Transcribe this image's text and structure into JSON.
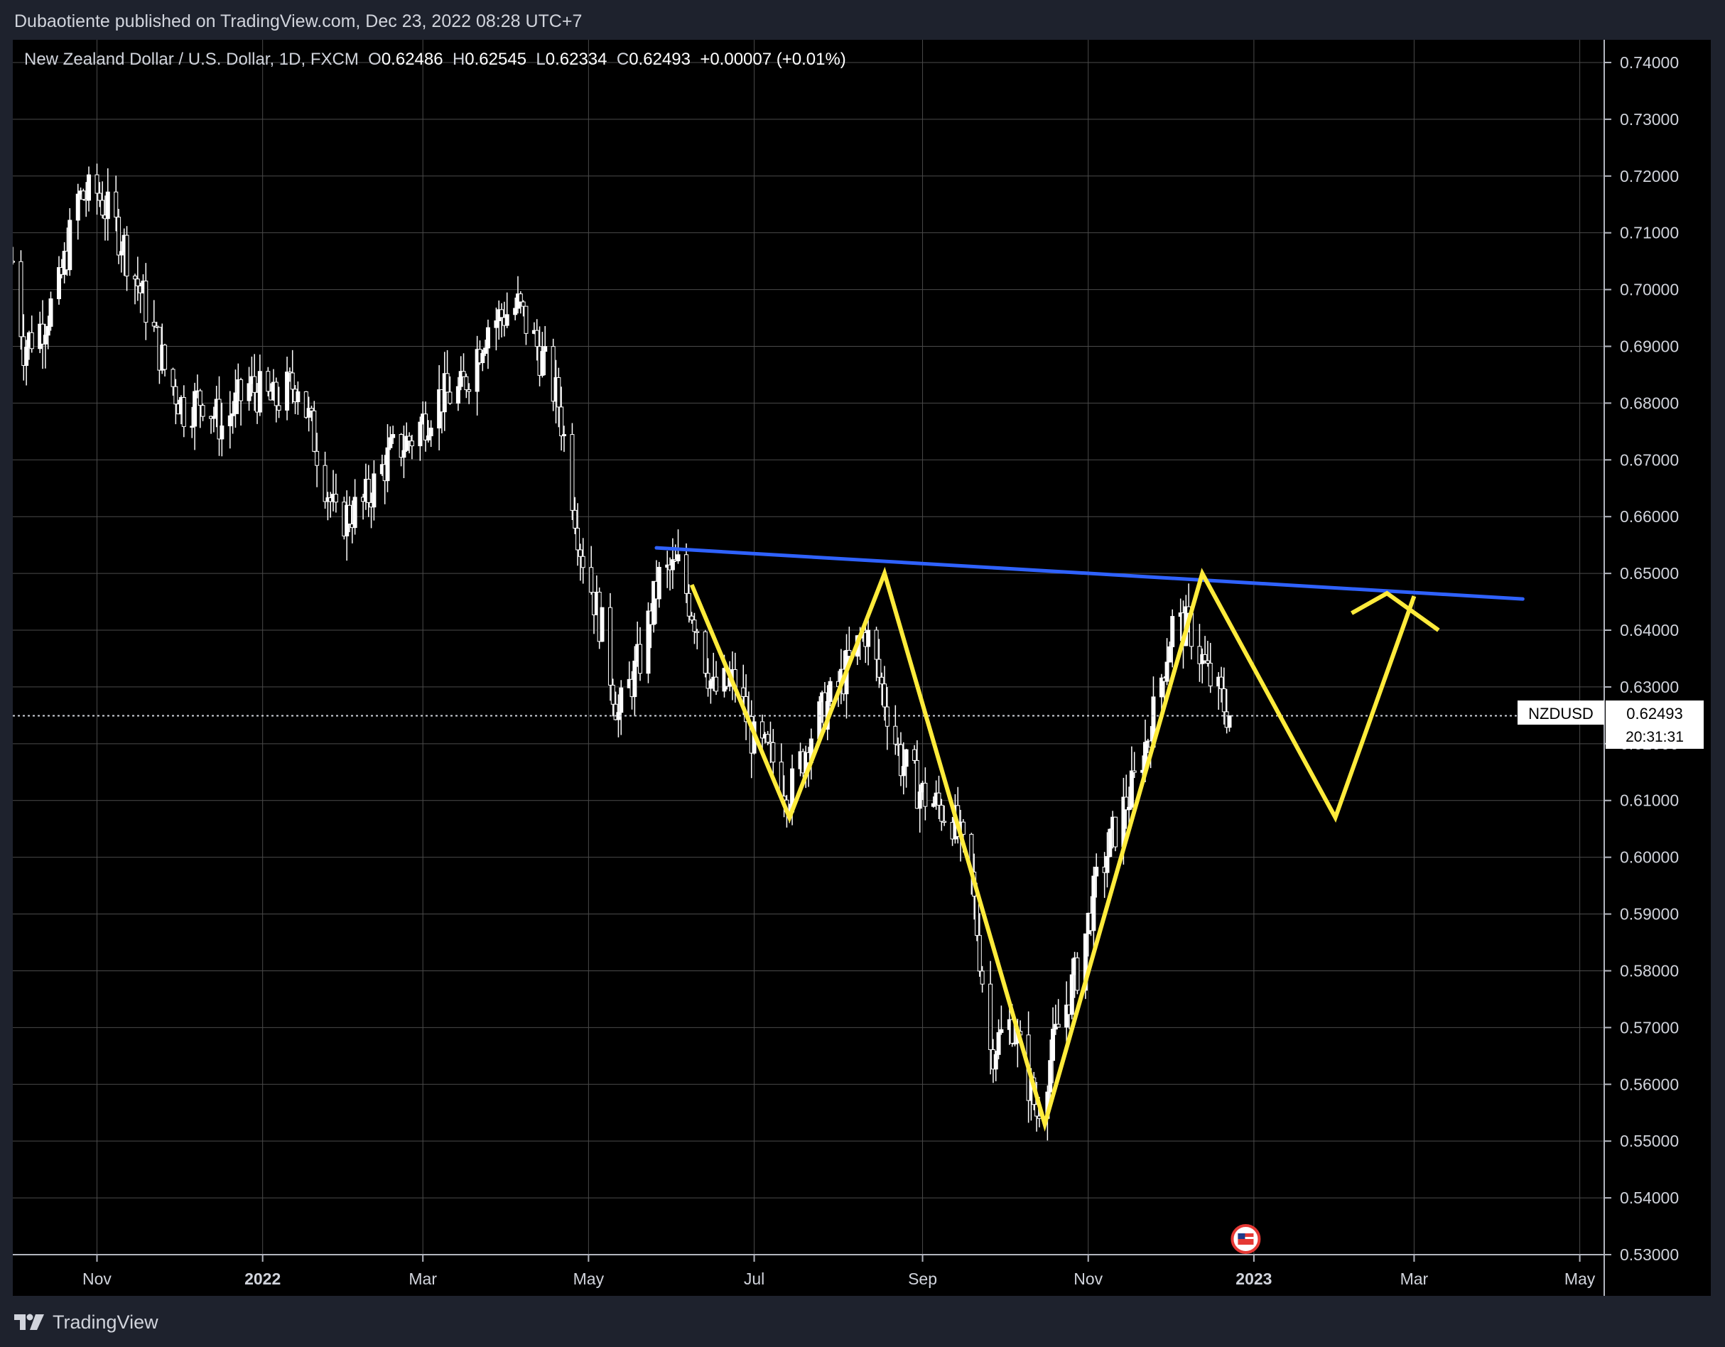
{
  "header": {
    "publisher_line": "Dubaotiente published on TradingView.com, Dec 23, 2022 08:28 UTC+7"
  },
  "legend": {
    "instrument": "New Zealand Dollar / U.S. Dollar, 1D, FXCM",
    "o_label": "O",
    "o_value": "0.62486",
    "h_label": "H",
    "h_value": "0.62545",
    "l_label": "L",
    "l_value": "0.62334",
    "c_label": "C",
    "c_value": "0.62493",
    "change": "+0.00007 (+0.01%)"
  },
  "price_tag": {
    "symbol": "NZDUSD",
    "price": "0.62493",
    "countdown": "20:31:31"
  },
  "footer": {
    "brand": "TradingView"
  },
  "colors": {
    "background": "#000000",
    "frame": "#1e222d",
    "candles": "#ffffff",
    "grid": "#4a4a4a",
    "trendline": "#2f62ff",
    "projection": "#ffeb3b"
  },
  "icons": {
    "event_marker": "us-flag-event-icon",
    "brand": "tradingview-logo-icon"
  },
  "chart_data": {
    "type": "candlestick",
    "title": "New Zealand Dollar / U.S. Dollar, 1D, FXCM",
    "xlabel": "",
    "ylabel": "",
    "ylim": [
      0.53,
      0.744
    ],
    "xlim": [
      "2021-10-01",
      "2023-05-10"
    ],
    "y_ticks": [
      "0.74000",
      "0.73000",
      "0.72000",
      "0.71000",
      "0.70000",
      "0.69000",
      "0.68000",
      "0.67000",
      "0.66000",
      "0.65000",
      "0.64000",
      "0.63000",
      "0.62000",
      "0.61000",
      "0.60000",
      "0.59000",
      "0.58000",
      "0.57000",
      "0.56000",
      "0.55000",
      "0.54000",
      "0.53000"
    ],
    "y_tick_values": [
      0.74,
      0.73,
      0.72,
      0.71,
      0.7,
      0.69,
      0.68,
      0.67,
      0.66,
      0.65,
      0.64,
      0.63,
      0.62,
      0.61,
      0.6,
      0.59,
      0.58,
      0.57,
      0.56,
      0.55,
      0.54,
      0.53
    ],
    "x_ticks": [
      {
        "label": "Nov",
        "date": "2021-11-01"
      },
      {
        "label": "2022",
        "date": "2022-01-01"
      },
      {
        "label": "Mar",
        "date": "2022-03-01"
      },
      {
        "label": "May",
        "date": "2022-05-01"
      },
      {
        "label": "Jul",
        "date": "2022-07-01"
      },
      {
        "label": "Sep",
        "date": "2022-09-01"
      },
      {
        "label": "Nov",
        "date": "2022-11-01"
      },
      {
        "label": "2023",
        "date": "2023-01-01"
      },
      {
        "label": "Mar",
        "date": "2023-03-01"
      },
      {
        "label": "May",
        "date": "2023-05-01"
      }
    ],
    "grid": true,
    "last_price": 0.62493,
    "price_path": [
      {
        "date": "2021-10-01",
        "close": 0.705
      },
      {
        "date": "2021-10-05",
        "close": 0.69
      },
      {
        "date": "2021-10-12",
        "close": 0.694
      },
      {
        "date": "2021-10-18",
        "close": 0.7
      },
      {
        "date": "2021-10-25",
        "close": 0.716
      },
      {
        "date": "2021-11-01",
        "close": 0.717
      },
      {
        "date": "2021-11-10",
        "close": 0.709
      },
      {
        "date": "2021-11-19",
        "close": 0.697
      },
      {
        "date": "2021-11-26",
        "close": 0.686
      },
      {
        "date": "2021-12-03",
        "close": 0.679
      },
      {
        "date": "2021-12-10",
        "close": 0.681
      },
      {
        "date": "2021-12-17",
        "close": 0.676
      },
      {
        "date": "2021-12-27",
        "close": 0.683
      },
      {
        "date": "2022-01-05",
        "close": 0.68
      },
      {
        "date": "2022-01-14",
        "close": 0.684
      },
      {
        "date": "2022-01-21",
        "close": 0.672
      },
      {
        "date": "2022-01-28",
        "close": 0.659
      },
      {
        "date": "2022-02-07",
        "close": 0.662
      },
      {
        "date": "2022-02-17",
        "close": 0.671
      },
      {
        "date": "2022-02-25",
        "close": 0.674
      },
      {
        "date": "2022-03-07",
        "close": 0.681
      },
      {
        "date": "2022-03-15",
        "close": 0.682
      },
      {
        "date": "2022-03-25",
        "close": 0.694
      },
      {
        "date": "2022-04-05",
        "close": 0.697
      },
      {
        "date": "2022-04-12",
        "close": 0.69
      },
      {
        "date": "2022-04-20",
        "close": 0.68
      },
      {
        "date": "2022-04-28",
        "close": 0.655
      },
      {
        "date": "2022-05-06",
        "close": 0.64
      },
      {
        "date": "2022-05-12",
        "close": 0.625
      },
      {
        "date": "2022-05-20",
        "close": 0.635
      },
      {
        "date": "2022-05-27",
        "close": 0.649
      },
      {
        "date": "2022-06-03",
        "close": 0.651
      },
      {
        "date": "2022-06-10",
        "close": 0.641
      },
      {
        "date": "2022-06-16",
        "close": 0.629
      },
      {
        "date": "2022-06-24",
        "close": 0.631
      },
      {
        "date": "2022-07-01",
        "close": 0.62
      },
      {
        "date": "2022-07-08",
        "close": 0.617
      },
      {
        "date": "2022-07-14",
        "close": 0.611
      },
      {
        "date": "2022-07-22",
        "close": 0.622
      },
      {
        "date": "2022-08-01",
        "close": 0.63
      },
      {
        "date": "2022-08-11",
        "close": 0.64
      },
      {
        "date": "2022-08-17",
        "close": 0.63
      },
      {
        "date": "2022-08-24",
        "close": 0.617
      },
      {
        "date": "2022-09-01",
        "close": 0.611
      },
      {
        "date": "2022-09-12",
        "close": 0.607
      },
      {
        "date": "2022-09-19",
        "close": 0.596
      },
      {
        "date": "2022-09-26",
        "close": 0.566
      },
      {
        "date": "2022-10-04",
        "close": 0.571
      },
      {
        "date": "2022-10-13",
        "close": 0.555
      },
      {
        "date": "2022-10-21",
        "close": 0.57
      },
      {
        "date": "2022-10-28",
        "close": 0.58
      },
      {
        "date": "2022-11-04",
        "close": 0.595
      },
      {
        "date": "2022-11-11",
        "close": 0.605
      },
      {
        "date": "2022-11-18",
        "close": 0.613
      },
      {
        "date": "2022-11-25",
        "close": 0.625
      },
      {
        "date": "2022-12-02",
        "close": 0.641
      },
      {
        "date": "2022-12-09",
        "close": 0.64
      },
      {
        "date": "2022-12-15",
        "close": 0.632
      },
      {
        "date": "2022-12-23",
        "close": 0.62493
      }
    ],
    "drawings": {
      "trendline": [
        {
          "date": "2022-05-26",
          "price": 0.6545
        },
        {
          "date": "2023-04-10",
          "price": 0.6455
        }
      ],
      "zigzag_pattern": [
        {
          "date": "2022-06-08",
          "price": 0.648
        },
        {
          "date": "2022-07-14",
          "price": 0.607
        },
        {
          "date": "2022-08-18",
          "price": 0.65
        },
        {
          "date": "2022-10-16",
          "price": 0.553
        },
        {
          "date": "2022-12-13",
          "price": 0.65
        },
        {
          "date": "2023-01-31",
          "price": 0.607
        },
        {
          "date": "2023-03-01",
          "price": 0.646
        }
      ],
      "arrow_head": [
        {
          "date": "2023-02-06",
          "price": 0.643
        },
        {
          "date": "2023-02-19",
          "price": 0.6465
        },
        {
          "date": "2023-03-10",
          "price": 0.64
        }
      ]
    },
    "event_marker": {
      "date": "2022-12-29",
      "icon": "us-flag-event-icon"
    }
  }
}
